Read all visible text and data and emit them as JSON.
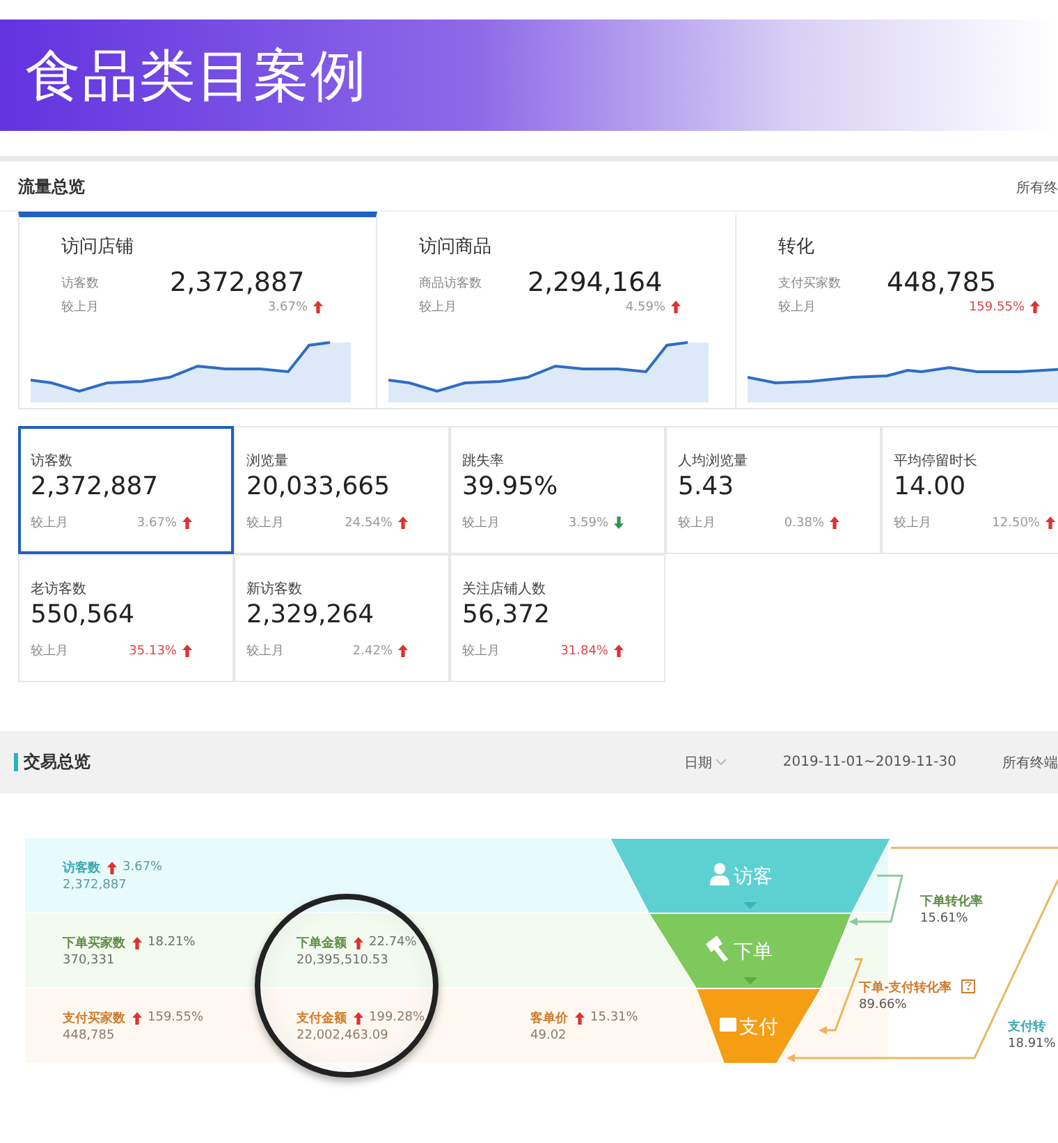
{
  "banner": {
    "title": "食品类目案例"
  },
  "traffic": {
    "title": "流量总览",
    "scope": "所有终",
    "cards": [
      {
        "title": "访问店铺",
        "metric_label": "访客数",
        "value": "2,372,887",
        "compare_label": "较上月",
        "change": "3.67%",
        "rising": true,
        "emphasis": false,
        "selected": true
      },
      {
        "title": "访问商品",
        "metric_label": "商品访客数",
        "value": "2,294,164",
        "compare_label": "较上月",
        "change": "4.59%",
        "rising": true,
        "emphasis": false,
        "selected": false
      },
      {
        "title": "转化",
        "metric_label": "支付买家数",
        "value": "448,785",
        "compare_label": "较上月",
        "change": "159.55%",
        "rising": true,
        "emphasis": true,
        "selected": false
      }
    ],
    "metrics": [
      {
        "label": "访客数",
        "value": "2,372,887",
        "compare_label": "较上月",
        "change": "3.67%",
        "rising": true,
        "emphasis": false,
        "selected": true
      },
      {
        "label": "浏览量",
        "value": "20,033,665",
        "compare_label": "较上月",
        "change": "24.54%",
        "rising": true,
        "emphasis": false,
        "selected": false
      },
      {
        "label": "跳失率",
        "value": "39.95%",
        "compare_label": "较上月",
        "change": "3.59%",
        "rising": false,
        "emphasis": false,
        "selected": false
      },
      {
        "label": "人均浏览量",
        "value": "5.43",
        "compare_label": "较上月",
        "change": "0.38%",
        "rising": true,
        "emphasis": false,
        "selected": false
      },
      {
        "label": "平均停留时长",
        "value": "14.00",
        "compare_label": "较上月",
        "change": "12.50%",
        "rising": true,
        "emphasis": false,
        "selected": false
      },
      {
        "label": "老访客数",
        "value": "550,564",
        "compare_label": "较上月",
        "change": "35.13%",
        "rising": true,
        "emphasis": true,
        "selected": false
      },
      {
        "label": "新访客数",
        "value": "2,329,264",
        "compare_label": "较上月",
        "change": "2.42%",
        "rising": true,
        "emphasis": false,
        "selected": false
      },
      {
        "label": "关注店铺人数",
        "value": "56,372",
        "compare_label": "较上月",
        "change": "31.84%",
        "rising": true,
        "emphasis": true,
        "selected": false
      }
    ]
  },
  "trade": {
    "title": "交易总览",
    "date_label": "日期",
    "date_range": "2019-11-01~2019-11-30",
    "scope": "所有终端",
    "rows": [
      {
        "kind": "visitor",
        "items": [
          {
            "label": "访客数",
            "change": "3.67%",
            "value": "2,372,887"
          }
        ]
      },
      {
        "kind": "order",
        "items": [
          {
            "label": "下单买家数",
            "change": "18.21%",
            "value": "370,331"
          },
          {
            "label": "下单金额",
            "change": "22.74%",
            "value": "20,395,510.53"
          }
        ]
      },
      {
        "kind": "pay",
        "items": [
          {
            "label": "支付买家数",
            "change": "159.55%",
            "value": "448,785"
          },
          {
            "label": "支付金额",
            "change": "199.28%",
            "value": "22,002,463.09"
          },
          {
            "label": "客单价",
            "change": "15.31%",
            "value": "49.02"
          }
        ]
      }
    ],
    "stages": [
      {
        "kind": "visitor",
        "label": "访客"
      },
      {
        "kind": "order",
        "label": "下单"
      },
      {
        "kind": "pay",
        "label": "支付"
      }
    ],
    "rates": [
      {
        "kind": "order",
        "label": "下单转化率",
        "value": "15.61%",
        "help": false
      },
      {
        "kind": "pay",
        "label": "下单-支付转化率",
        "value": "89.66%",
        "help": true
      },
      {
        "kind": "visitor",
        "label": "支付转",
        "value": "18.91%"
      }
    ]
  }
}
